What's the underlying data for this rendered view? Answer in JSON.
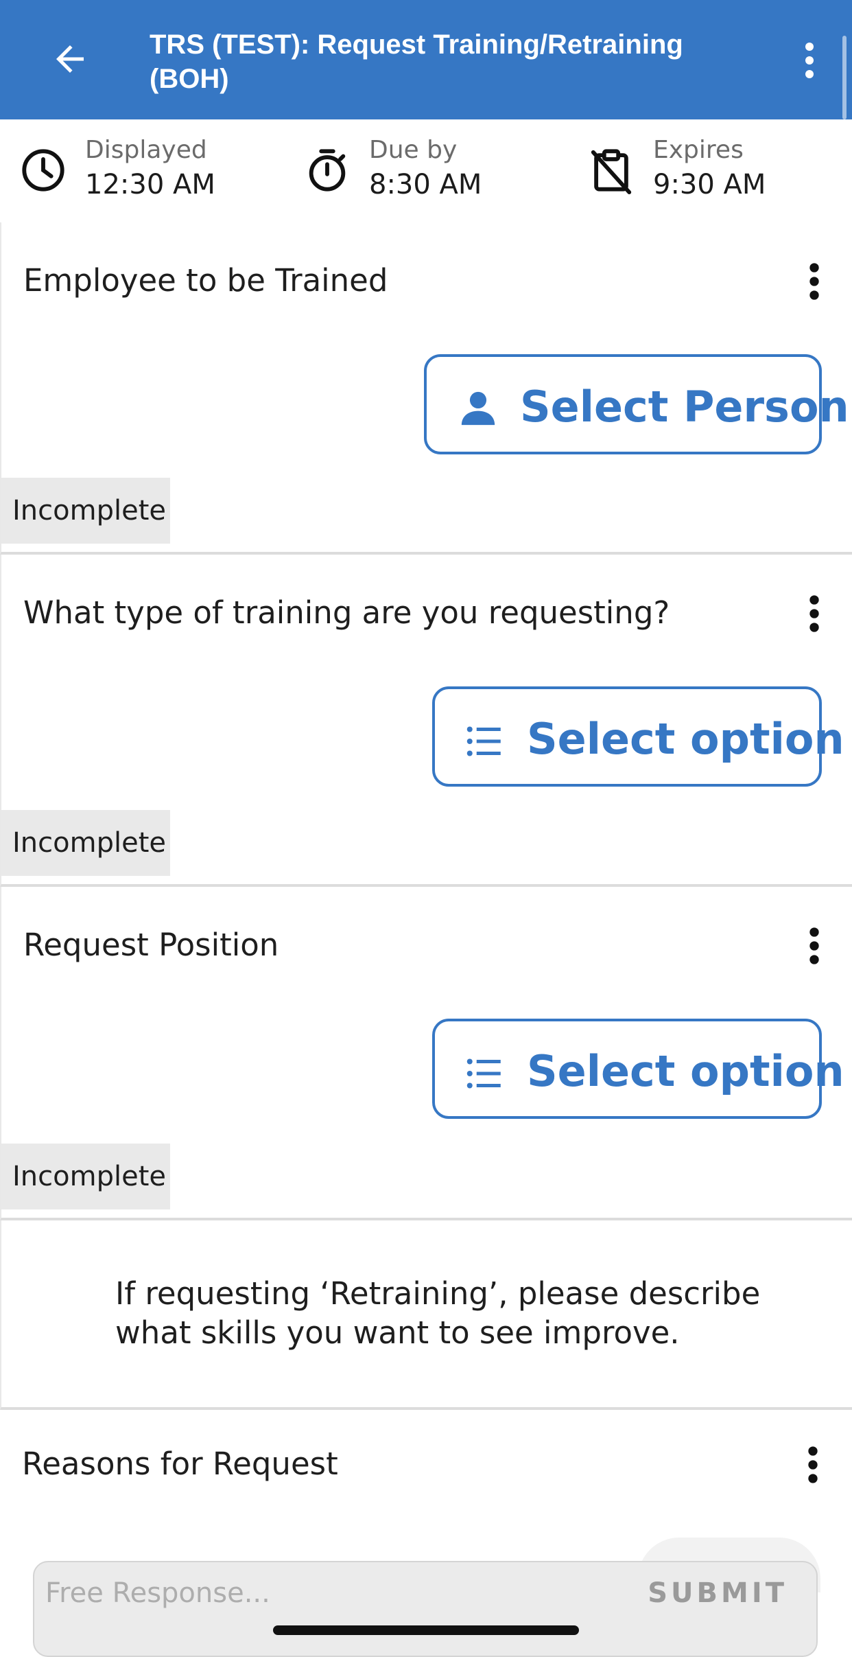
{
  "header": {
    "title": "TRS (TEST): Request Training/Retraining (BOH)",
    "back_icon": "arrow-left-icon",
    "menu_icon": "more-vertical-icon"
  },
  "info": {
    "displayed_label": "Displayed",
    "displayed_value": "12:30 AM",
    "due_label": "Due by",
    "due_value": "8:30 AM",
    "expires_label": "Expires",
    "expires_value": "9:30 AM"
  },
  "questions": [
    {
      "label": "Employee to be Trained",
      "button": "Select Person",
      "button_icon": "person-icon",
      "status": "Incomplete"
    },
    {
      "label": "What type of training are you requesting?",
      "button": "Select option",
      "button_icon": "list-icon",
      "status": "Incomplete"
    },
    {
      "label": "Request Position",
      "button": "Select option",
      "button_icon": "list-icon",
      "status": "Incomplete"
    }
  ],
  "instruction": "If requesting ‘Retraining’, please describe what skills you want to see improve.",
  "reasons": {
    "label": "Reasons for Request",
    "placeholder": "Free Response...",
    "submit_label": "SUBMIT"
  },
  "colors": {
    "brand_blue": "#3677c4",
    "status_bg": "#e9e9e9"
  }
}
